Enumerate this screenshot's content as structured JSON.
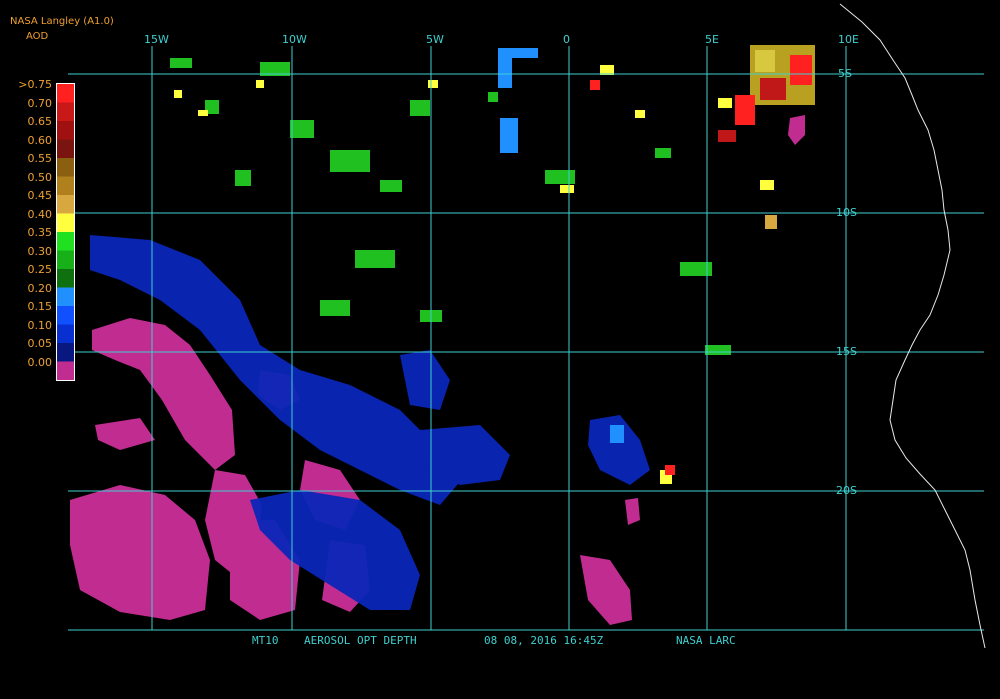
{
  "header": {
    "title": "NASA Langley (A1.0)",
    "subtitle": "AOD"
  },
  "colorbar": {
    "labels": [
      ">0.75",
      "0.70",
      "0.65",
      "0.60",
      "0.55",
      "0.50",
      "0.45",
      "0.40",
      "0.35",
      "0.30",
      "0.25",
      "0.20",
      "0.15",
      "0.10",
      "0.05",
      "0.00"
    ],
    "colors": [
      "#ff2020",
      "#c81818",
      "#a01010",
      "#7a1410",
      "#8a6010",
      "#b0801c",
      "#d8a840",
      "#ffff40",
      "#20e020",
      "#18b018",
      "#0e700e",
      "#2090ff",
      "#1050ff",
      "#0830d0",
      "#081880",
      "#c02c90"
    ]
  },
  "grid": {
    "lon_labels": [
      "15W",
      "10W",
      "5W",
      "0",
      "5E",
      "10E"
    ],
    "lat_labels": [
      "5S",
      "10S",
      "15S",
      "20S"
    ]
  },
  "footer": {
    "product": "MT10",
    "field": "AEROSOL OPT DEPTH",
    "datetime": "08 08, 2016 16:45Z",
    "source": "NASA LARC"
  },
  "palette": {
    "grid": "#3fd0d0",
    "coast": "#e8e8e8",
    "text": "#f0a030"
  }
}
